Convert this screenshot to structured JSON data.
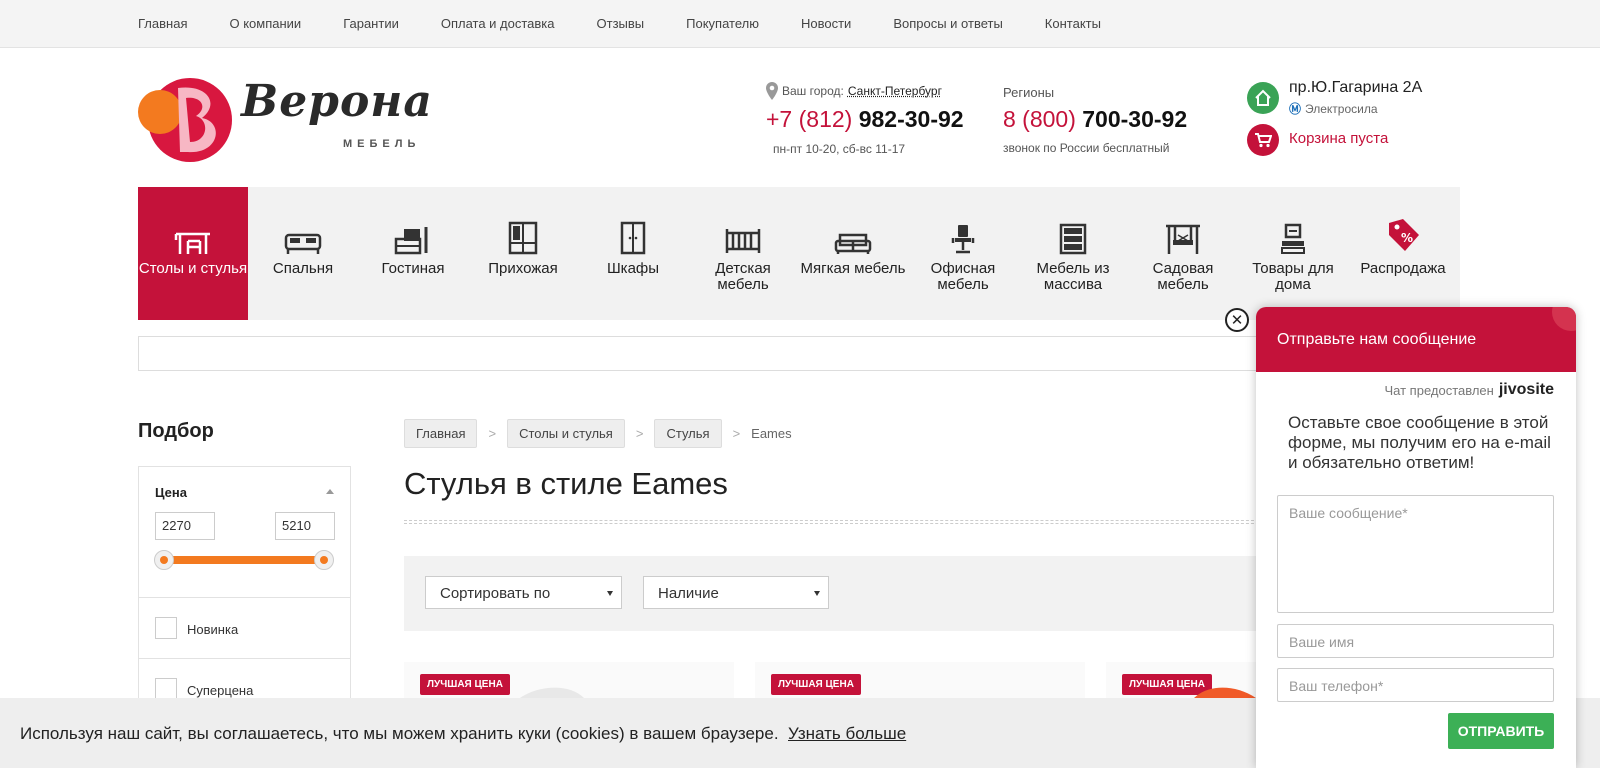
{
  "top_nav": [
    "Главная",
    "О компании",
    "Гарантии",
    "Оплата и доставка",
    "Отзывы",
    "Покупателю",
    "Новости",
    "Вопросы и ответы",
    "Контакты"
  ],
  "logo": {
    "word": "Верона",
    "sub": "МЕБЕЛЬ"
  },
  "header": {
    "city_label": "Ваш город:",
    "city_name": "Санкт-Петербург",
    "phone1_code": "+7 (812)",
    "phone1_num": "982-30-92",
    "hours": "пн-пт 10-20, сб-вс 11-17",
    "regions_label": "Регионы",
    "phone2_code": "8 (800)",
    "phone2_num": "700-30-92",
    "free_call": "звонок по России бесплатный",
    "address": "пр.Ю.Гагарина 2А",
    "metro": "Электросила",
    "cart": "Корзина пуста"
  },
  "categories": [
    {
      "label": "Столы и стулья",
      "icon": "table-chair-icon",
      "active": true
    },
    {
      "label": "Спальня",
      "icon": "bed-icon",
      "active": false
    },
    {
      "label": "Гостиная",
      "icon": "tv-stand-icon",
      "active": false
    },
    {
      "label": "Прихожая",
      "icon": "hallway-cabinet-icon",
      "active": false
    },
    {
      "label": "Шкафы",
      "icon": "wardrobe-icon",
      "active": false
    },
    {
      "label": "Детская мебель",
      "icon": "crib-icon",
      "active": false
    },
    {
      "label": "Мягкая мебель",
      "icon": "sofa-icon",
      "active": false
    },
    {
      "label": "Офисная мебель",
      "icon": "office-chair-icon",
      "active": false
    },
    {
      "label": "Мебель из массива",
      "icon": "drawer-chest-icon",
      "active": false
    },
    {
      "label": "Садовая мебель",
      "icon": "garden-swing-icon",
      "active": false
    },
    {
      "label": "Товары для дома",
      "icon": "home-goods-icon",
      "active": false
    },
    {
      "label": "Распродажа",
      "icon": "sale-tag-icon",
      "active": false
    }
  ],
  "filter": {
    "title": "Подбор",
    "price_label": "Цена",
    "price_min": "2270",
    "price_max": "5210",
    "checkboxes": [
      "Новинка",
      "Суперцена"
    ]
  },
  "breadcrumbs": [
    "Главная",
    "Столы и стулья",
    "Стулья"
  ],
  "breadcrumb_current": "Eames",
  "page_title": "Стулья в стиле Eames",
  "toolbar": {
    "sort": "Сортировать по",
    "stock": "Наличие"
  },
  "product_badge": "ЛУЧШАЯ ЦЕНА",
  "cookie": {
    "text": "Используя наш сайт, вы соглашаетесь, что мы можем хранить куки (cookies) в вашем браузере.",
    "link": "Узнать больше"
  },
  "chat": {
    "close": "✕",
    "title": "Отправьте нам сообщение",
    "provided": "Чат предоставлен",
    "brand": "jivosite",
    "intro": "Оставьте свое сообщение в этой форме, мы получим его на e-mail и обязательно ответим!",
    "msg_placeholder": "Ваше сообщение*",
    "name_placeholder": "Ваше имя",
    "phone_placeholder": "Ваш телефон*",
    "send": "ОТПРАВИТЬ"
  },
  "colors": {
    "brand": "#c4123a",
    "accent_orange": "#f37a1f",
    "send_green": "#3cb056"
  }
}
